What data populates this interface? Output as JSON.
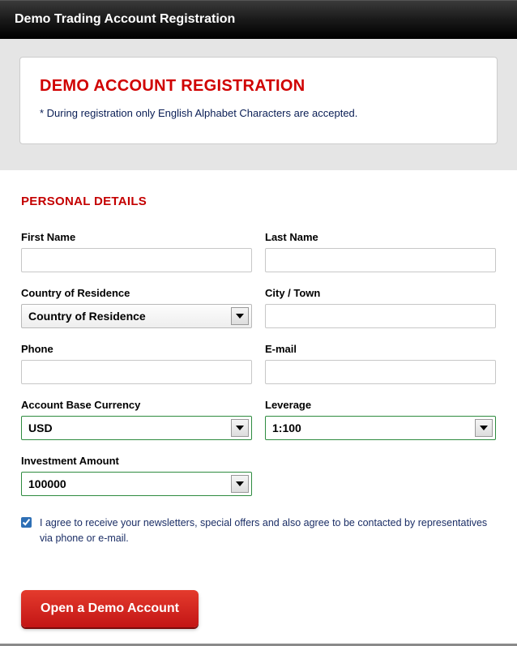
{
  "window": {
    "title": "Demo Trading Account Registration"
  },
  "header": {
    "title": "DEMO ACCOUNT REGISTRATION",
    "note": "* During registration only English Alphabet Characters are accepted."
  },
  "sections": {
    "personal_details_title": "PERSONAL DETAILS"
  },
  "fields": {
    "first_name": {
      "label": "First Name",
      "value": ""
    },
    "last_name": {
      "label": "Last Name",
      "value": ""
    },
    "country": {
      "label": "Country of Residence",
      "value": "Country of Residence"
    },
    "city": {
      "label": "City / Town",
      "value": ""
    },
    "phone": {
      "label": "Phone",
      "value": ""
    },
    "email": {
      "label": "E-mail",
      "value": ""
    },
    "currency": {
      "label": "Account Base Currency",
      "value": "USD"
    },
    "leverage": {
      "label": "Leverage",
      "value": "1:100"
    },
    "investment": {
      "label": "Investment Amount",
      "value": "100000"
    }
  },
  "consent": {
    "checked": true,
    "text": "I agree to receive your newsletters, special offers and also agree to be contacted by representatives via phone or e-mail."
  },
  "submit": {
    "label": "Open a Demo Account"
  }
}
